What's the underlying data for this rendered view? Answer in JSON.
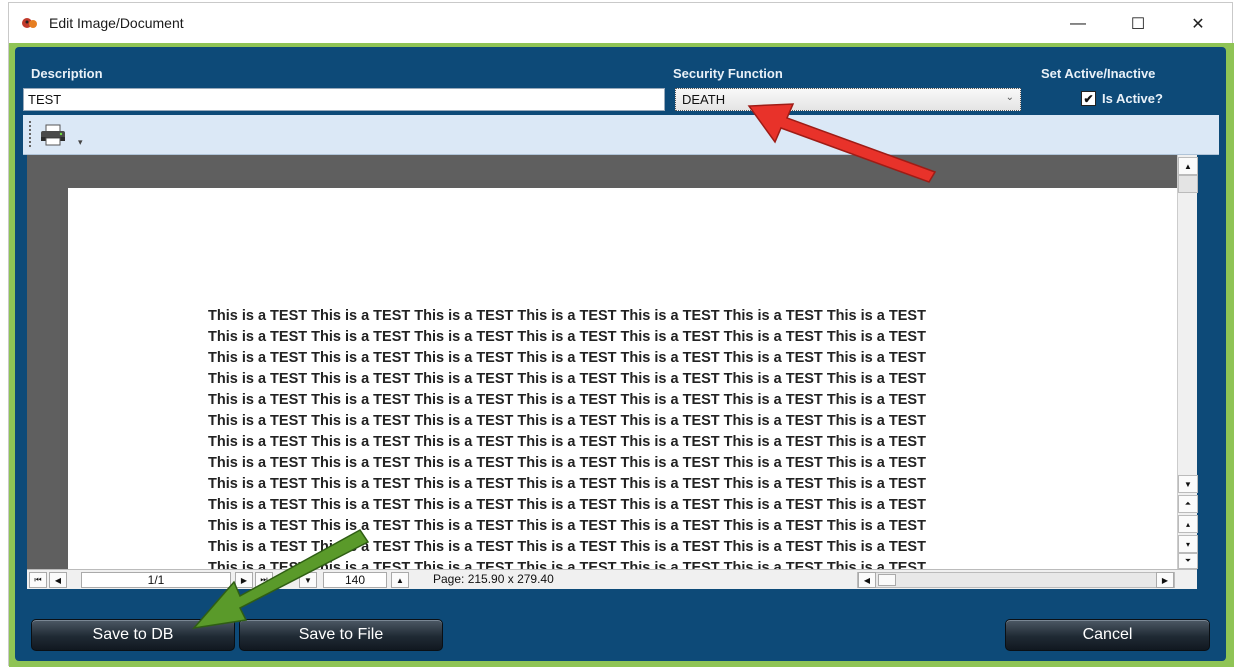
{
  "window": {
    "title": "Edit Image/Document",
    "minimize_glyph": "—",
    "maximize_glyph": "☐",
    "close_glyph": "✕"
  },
  "labels": {
    "description": "Description",
    "security_function": "Security Function",
    "set_active": "Set Active/Inactive"
  },
  "fields": {
    "description_value": "TEST",
    "security_function_value": "DEATH",
    "is_active_label": "Is Active?",
    "is_active_checked": true
  },
  "document": {
    "lines": [
      "This is a TEST This is a TEST This is a TEST This is a TEST This is a TEST This is a TEST This is a TEST",
      "This is a TEST This is a TEST This is a TEST This is a TEST This is a TEST This is a TEST This is a TEST",
      "This is a TEST This is a TEST This is a TEST This is a TEST This is a TEST This is a TEST This is a TEST",
      "This is a TEST This is a TEST This is a TEST This is a TEST This is a TEST This is a TEST This is a TEST",
      "This is a TEST This is a TEST This is a TEST This is a TEST This is a TEST This is a TEST This is a TEST",
      "This is a TEST This is a TEST This is a TEST This is a TEST This is a TEST This is a TEST This is a TEST",
      "This is a TEST This is a TEST This is a TEST This is a TEST This is a TEST This is a TEST This is a TEST",
      "This is a TEST This is a TEST This is a TEST This is a TEST This is a TEST This is a TEST This is a TEST",
      "This is a TEST This is a TEST This is a TEST This is a TEST This is a TEST This is a TEST This is a TEST",
      "This is a TEST This is a TEST This is a TEST This is a TEST This is a TEST This is a TEST This is a TEST",
      "This is a TEST This is a TEST This is a TEST This is a TEST This is a TEST This is a TEST This is a TEST",
      "This is a TEST This is a TEST This is a TEST This is a TEST This is a TEST This is a TEST This is a TEST",
      "This is a TEST This is a TEST This is a TEST This is a TEST This is a TEST This is a TEST This is a TEST"
    ]
  },
  "status": {
    "page_indicator": "1/1",
    "zoom": "140",
    "page_size": "Page: 215.90 x 279.40"
  },
  "buttons": {
    "save_db": "Save to DB",
    "save_file": "Save to File",
    "cancel": "Cancel"
  },
  "colors": {
    "panel_bg": "#0d4a78",
    "frame_green": "#8fc455",
    "annotation_red": "#e8322a",
    "annotation_green": "#5a9a2a"
  },
  "icons": {
    "app": "app-logo-icon",
    "printer": "printer-icon",
    "checkbox": "checkmark-icon"
  }
}
